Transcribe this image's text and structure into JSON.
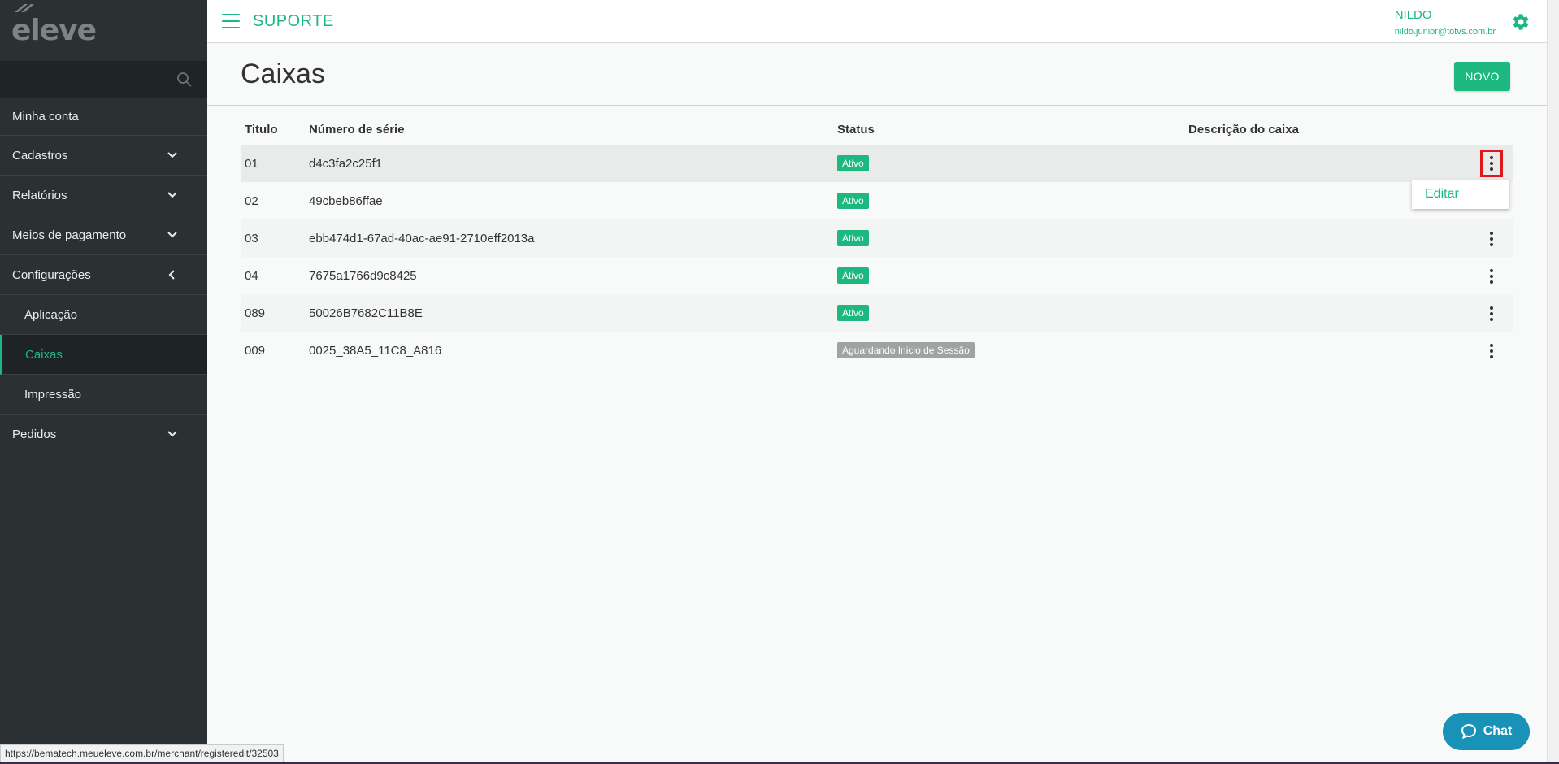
{
  "sidebar": {
    "logo_text": "eleve",
    "items": [
      {
        "label": "Minha conta"
      },
      {
        "label": "Cadastros"
      },
      {
        "label": "Relatórios"
      },
      {
        "label": "Meios de pagamento"
      },
      {
        "label": "Configurações"
      },
      {
        "label": "Aplicação"
      },
      {
        "label": "Caixas"
      },
      {
        "label": "Impressão"
      },
      {
        "label": "Pedidos"
      }
    ]
  },
  "header": {
    "brand": "SUPORTE",
    "user_name": "NILDO",
    "user_email": "nildo.junior@totvs.com.br"
  },
  "page": {
    "title": "Caixas",
    "new_button": "NOVO"
  },
  "table": {
    "columns": [
      "Titulo",
      "Número de série",
      "Status",
      "Descrição do caixa"
    ],
    "rows": [
      {
        "titulo": "01",
        "serie": "d4c3fa2c25f1",
        "status": "Ativo",
        "descricao": ""
      },
      {
        "titulo": "02",
        "serie": "49cbeb86ffae",
        "status": "Ativo",
        "descricao": ""
      },
      {
        "titulo": "03",
        "serie": "ebb474d1-67ad-40ac-ae91-2710eff2013a",
        "status": "Ativo",
        "descricao": ""
      },
      {
        "titulo": "04",
        "serie": "7675a1766d9c8425",
        "status": "Ativo",
        "descricao": ""
      },
      {
        "titulo": "089",
        "serie": "50026B7682C11B8E",
        "status": "Ativo",
        "descricao": ""
      },
      {
        "titulo": "009",
        "serie": "0025_38A5_11C8_A816",
        "status": "Aguardando Inicio de Sessão",
        "descricao": ""
      }
    ]
  },
  "dropdown": {
    "edit_label": "Editar"
  },
  "status_url": "https://bematech.meueleve.com.br/merchant/registeredit/32503",
  "chat": {
    "label": "Chat"
  },
  "colors": {
    "accent": "#1db87f",
    "sidebar_bg": "#2b3133",
    "badge_grey": "#9ea3a4",
    "chat_bg": "#1992b8"
  }
}
